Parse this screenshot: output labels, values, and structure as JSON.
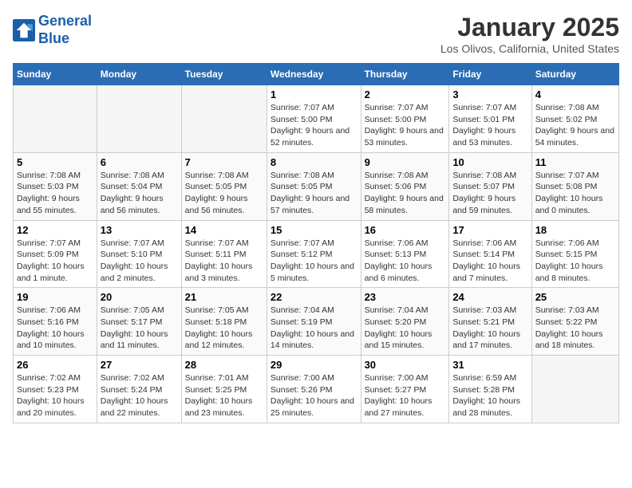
{
  "header": {
    "logo_line1": "General",
    "logo_line2": "Blue",
    "title": "January 2025",
    "subtitle": "Los Olivos, California, United States"
  },
  "days_of_week": [
    "Sunday",
    "Monday",
    "Tuesday",
    "Wednesday",
    "Thursday",
    "Friday",
    "Saturday"
  ],
  "weeks": [
    [
      {
        "day": "",
        "empty": true
      },
      {
        "day": "",
        "empty": true
      },
      {
        "day": "",
        "empty": true
      },
      {
        "day": "1",
        "sunrise": "7:07 AM",
        "sunset": "5:00 PM",
        "daylight": "9 hours and 52 minutes."
      },
      {
        "day": "2",
        "sunrise": "7:07 AM",
        "sunset": "5:00 PM",
        "daylight": "9 hours and 53 minutes."
      },
      {
        "day": "3",
        "sunrise": "7:07 AM",
        "sunset": "5:01 PM",
        "daylight": "9 hours and 53 minutes."
      },
      {
        "day": "4",
        "sunrise": "7:08 AM",
        "sunset": "5:02 PM",
        "daylight": "9 hours and 54 minutes."
      }
    ],
    [
      {
        "day": "5",
        "sunrise": "7:08 AM",
        "sunset": "5:03 PM",
        "daylight": "9 hours and 55 minutes."
      },
      {
        "day": "6",
        "sunrise": "7:08 AM",
        "sunset": "5:04 PM",
        "daylight": "9 hours and 56 minutes."
      },
      {
        "day": "7",
        "sunrise": "7:08 AM",
        "sunset": "5:05 PM",
        "daylight": "9 hours and 56 minutes."
      },
      {
        "day": "8",
        "sunrise": "7:08 AM",
        "sunset": "5:05 PM",
        "daylight": "9 hours and 57 minutes."
      },
      {
        "day": "9",
        "sunrise": "7:08 AM",
        "sunset": "5:06 PM",
        "daylight": "9 hours and 58 minutes."
      },
      {
        "day": "10",
        "sunrise": "7:08 AM",
        "sunset": "5:07 PM",
        "daylight": "9 hours and 59 minutes."
      },
      {
        "day": "11",
        "sunrise": "7:07 AM",
        "sunset": "5:08 PM",
        "daylight": "10 hours and 0 minutes."
      }
    ],
    [
      {
        "day": "12",
        "sunrise": "7:07 AM",
        "sunset": "5:09 PM",
        "daylight": "10 hours and 1 minute."
      },
      {
        "day": "13",
        "sunrise": "7:07 AM",
        "sunset": "5:10 PM",
        "daylight": "10 hours and 2 minutes."
      },
      {
        "day": "14",
        "sunrise": "7:07 AM",
        "sunset": "5:11 PM",
        "daylight": "10 hours and 3 minutes."
      },
      {
        "day": "15",
        "sunrise": "7:07 AM",
        "sunset": "5:12 PM",
        "daylight": "10 hours and 5 minutes."
      },
      {
        "day": "16",
        "sunrise": "7:06 AM",
        "sunset": "5:13 PM",
        "daylight": "10 hours and 6 minutes."
      },
      {
        "day": "17",
        "sunrise": "7:06 AM",
        "sunset": "5:14 PM",
        "daylight": "10 hours and 7 minutes."
      },
      {
        "day": "18",
        "sunrise": "7:06 AM",
        "sunset": "5:15 PM",
        "daylight": "10 hours and 8 minutes."
      }
    ],
    [
      {
        "day": "19",
        "sunrise": "7:06 AM",
        "sunset": "5:16 PM",
        "daylight": "10 hours and 10 minutes."
      },
      {
        "day": "20",
        "sunrise": "7:05 AM",
        "sunset": "5:17 PM",
        "daylight": "10 hours and 11 minutes."
      },
      {
        "day": "21",
        "sunrise": "7:05 AM",
        "sunset": "5:18 PM",
        "daylight": "10 hours and 12 minutes."
      },
      {
        "day": "22",
        "sunrise": "7:04 AM",
        "sunset": "5:19 PM",
        "daylight": "10 hours and 14 minutes."
      },
      {
        "day": "23",
        "sunrise": "7:04 AM",
        "sunset": "5:20 PM",
        "daylight": "10 hours and 15 minutes."
      },
      {
        "day": "24",
        "sunrise": "7:03 AM",
        "sunset": "5:21 PM",
        "daylight": "10 hours and 17 minutes."
      },
      {
        "day": "25",
        "sunrise": "7:03 AM",
        "sunset": "5:22 PM",
        "daylight": "10 hours and 18 minutes."
      }
    ],
    [
      {
        "day": "26",
        "sunrise": "7:02 AM",
        "sunset": "5:23 PM",
        "daylight": "10 hours and 20 minutes."
      },
      {
        "day": "27",
        "sunrise": "7:02 AM",
        "sunset": "5:24 PM",
        "daylight": "10 hours and 22 minutes."
      },
      {
        "day": "28",
        "sunrise": "7:01 AM",
        "sunset": "5:25 PM",
        "daylight": "10 hours and 23 minutes."
      },
      {
        "day": "29",
        "sunrise": "7:00 AM",
        "sunset": "5:26 PM",
        "daylight": "10 hours and 25 minutes."
      },
      {
        "day": "30",
        "sunrise": "7:00 AM",
        "sunset": "5:27 PM",
        "daylight": "10 hours and 27 minutes."
      },
      {
        "day": "31",
        "sunrise": "6:59 AM",
        "sunset": "5:28 PM",
        "daylight": "10 hours and 28 minutes."
      },
      {
        "day": "",
        "empty": true
      }
    ]
  ]
}
